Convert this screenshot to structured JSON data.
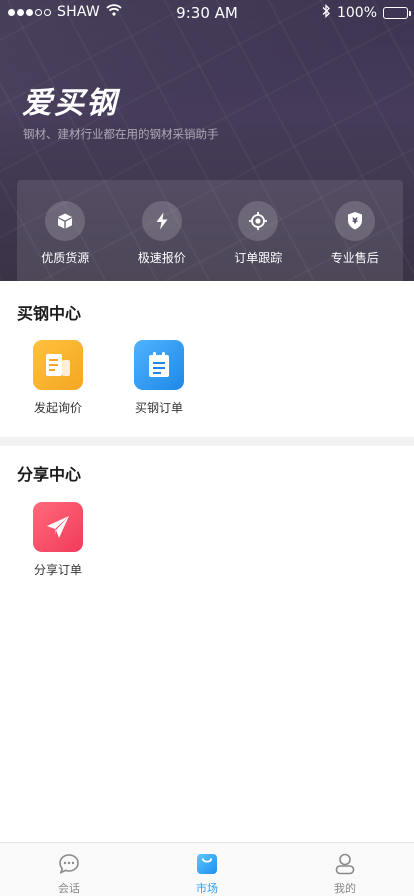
{
  "status_bar": {
    "carrier": "SHAW",
    "time": "9:30 AM",
    "battery": "100%",
    "signal_strength": 3,
    "icons": [
      "signal-icon",
      "wifi-icon",
      "bluetooth-icon",
      "battery-icon"
    ]
  },
  "hero": {
    "brand": "爱买钢",
    "slogan": "钢材、建材行业都在用的钢材采销助手",
    "features": [
      {
        "label": "优质货源",
        "icon": "cube-icon"
      },
      {
        "label": "极速报价",
        "icon": "lightning-icon"
      },
      {
        "label": "订单跟踪",
        "icon": "crosshair-icon"
      },
      {
        "label": "专业售后",
        "icon": "shield-yen-icon"
      }
    ]
  },
  "buy_center": {
    "title": "买钢中心",
    "items": [
      {
        "label": "发起询价",
        "icon": "document-icon",
        "color_from": "#ffc23d",
        "color_to": "#f5a623"
      },
      {
        "label": "买钢订单",
        "icon": "clipboard-icon",
        "color_from": "#4fb3ff",
        "color_to": "#1e88e5"
      }
    ]
  },
  "share_center": {
    "title": "分享中心",
    "items": [
      {
        "label": "分享订单",
        "icon": "paper-plane-icon",
        "color_from": "#ff6a7b",
        "color_to": "#f23b5c"
      }
    ]
  },
  "tabbar": {
    "active": "market",
    "active_color": "#2e9cf0",
    "tabs": [
      {
        "key": "chat",
        "label": "会话",
        "icon": "chat-bubble-icon"
      },
      {
        "key": "market",
        "label": "市场",
        "icon": "shopping-bag-icon"
      },
      {
        "key": "mine",
        "label": "我的",
        "icon": "user-icon"
      }
    ]
  }
}
